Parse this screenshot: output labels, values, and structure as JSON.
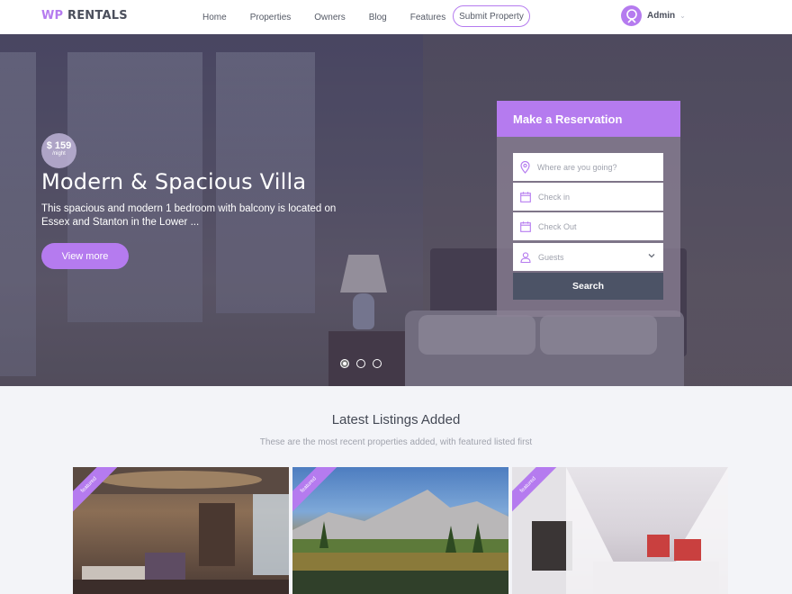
{
  "header": {
    "logo_wp": "WP",
    "logo_rentals": "RENTALS",
    "nav": [
      "Home",
      "Properties",
      "Owners",
      "Blog",
      "Features"
    ],
    "submit_label": "Submit Property",
    "user_name": "Admin",
    "caret": "⌄"
  },
  "hero": {
    "price": "$ 159",
    "price_unit": "/night",
    "title": "Modern & Spacious Villa",
    "description": "This spacious and modern 1 bedroom with balcony is located on Essex and Stanton in the Lower ...",
    "button_label": "View more",
    "slide_count": 3,
    "active_slide": 1
  },
  "reservation": {
    "title": "Make a Reservation",
    "destination_placeholder": "Where are you going?",
    "checkin_placeholder": "Check in",
    "checkout_placeholder": "Check Out",
    "guests_placeholder": "Guests",
    "search_label": "Search"
  },
  "listings": {
    "title": "Latest Listings Added",
    "subtitle": "These are the most recent properties added, with featured listed first",
    "cards": [
      {
        "ribbon": "featured"
      },
      {
        "ribbon": "featured"
      },
      {
        "ribbon": "featured"
      }
    ]
  },
  "colors": {
    "accent": "#b57bef",
    "search_button": "#4c5366"
  }
}
